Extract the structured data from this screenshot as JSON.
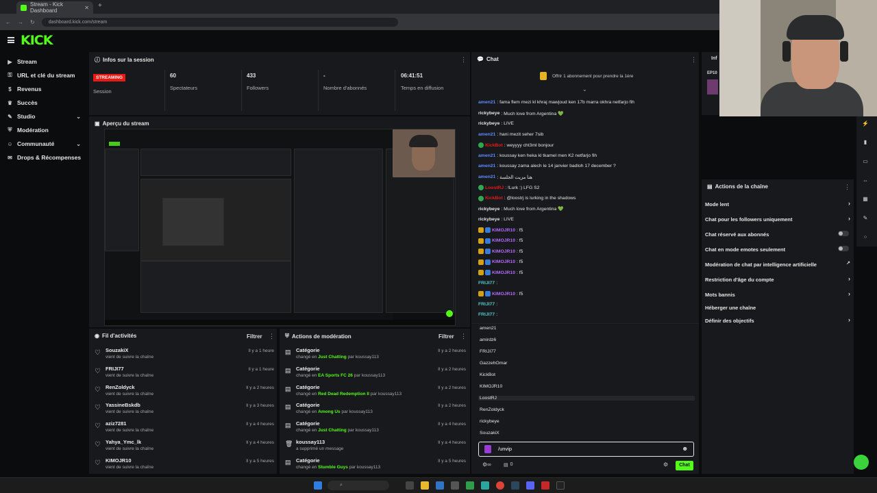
{
  "browser": {
    "tab_title": "Stream - Kick Dashboard",
    "url": "dashboard.kick.com/stream"
  },
  "brand": {
    "logo": "KICK",
    "accent": "#53fc18",
    "live_red": "#e91916"
  },
  "sidebar": {
    "items": [
      {
        "label": "Stream",
        "icon": "video-icon",
        "chevron": false,
        "active": true
      },
      {
        "label": "URL et clé du stream",
        "icon": "key-icon",
        "chevron": false
      },
      {
        "label": "Revenus",
        "icon": "money-icon",
        "chevron": false
      },
      {
        "label": "Succès",
        "icon": "trophy-icon",
        "chevron": false
      },
      {
        "label": "Studio",
        "icon": "studio-icon",
        "chevron": true
      },
      {
        "label": "Modération",
        "icon": "shield-icon",
        "chevron": false
      },
      {
        "label": "Communauté",
        "icon": "community-icon",
        "chevron": true
      },
      {
        "label": "Drops & Récompenses",
        "icon": "gift-icon",
        "chevron": false
      }
    ]
  },
  "session": {
    "title": "Infos sur la session",
    "status_badge": "STREAMING",
    "status_label": "Session",
    "stats": [
      {
        "value": "60",
        "label": "Spectateurs"
      },
      {
        "value": "433",
        "label": "Followers"
      },
      {
        "value": "-",
        "label": "Nombre d'abonnés"
      },
      {
        "value": "06:41:51",
        "label": "Temps en diffusion"
      }
    ]
  },
  "preview": {
    "title": "Aperçu du stream"
  },
  "activity": {
    "title": "Fil d'activités",
    "filter_label": "Filtrer",
    "rows": [
      {
        "name": "SouzakiX",
        "desc": "vient de suivre la chaîne",
        "time": "Il y a 1 heure"
      },
      {
        "name": "FRIJI77",
        "desc": "vient de suivre la chaîne",
        "time": "Il y a 1 heure"
      },
      {
        "name": "RenZoldyck",
        "desc": "vient de suivre la chaîne",
        "time": "Il y a 2 heures"
      },
      {
        "name": "YassineBskdb",
        "desc": "vient de suivre la chaîne",
        "time": "Il y a 3 heures"
      },
      {
        "name": "aziz7281",
        "desc": "vient de suivre la chaîne",
        "time": "Il y a 4 heures"
      },
      {
        "name": "Yahya_Ymc_lk",
        "desc": "vient de suivre la chaîne",
        "time": "Il y a 4 heures"
      },
      {
        "name": "KIMOJR10",
        "desc": "vient de suivre la chaîne",
        "time": "Il y a 5 heures"
      }
    ]
  },
  "moderation": {
    "title": "Actions de modération",
    "filter_label": "Filtrer",
    "rows": [
      {
        "icon": "category-icon",
        "name": "Catégorie",
        "pre": "changé en ",
        "game": "Just Chatting",
        "by": " par koussay113",
        "time": "Il y a 2 heures"
      },
      {
        "icon": "category-icon",
        "name": "Catégorie",
        "pre": "changé en ",
        "game": "EA Sports FC 26",
        "by": " par koussay113",
        "time": "Il y a 2 heures"
      },
      {
        "icon": "category-icon",
        "name": "Catégorie",
        "pre": "changé en ",
        "game": "Red Dead Redemption II",
        "by": " par koussay113",
        "time": "Il y a 2 heures"
      },
      {
        "icon": "category-icon",
        "name": "Catégorie",
        "pre": "changé en ",
        "game": "Among Us",
        "by": " par koussay113",
        "time": "Il y a 2 heures"
      },
      {
        "icon": "category-icon",
        "name": "Catégorie",
        "pre": "changé en ",
        "game": "Just Chatting",
        "by": " par koussay113",
        "time": "Il y a 4 heures"
      },
      {
        "icon": "trash-icon",
        "name": "koussay113",
        "pre": "a supprimé un message",
        "game": "",
        "by": "",
        "time": "Il y a 4 heures"
      },
      {
        "icon": "category-icon",
        "name": "Catégorie",
        "pre": "changé en ",
        "game": "Stumble Guys",
        "by": " par koussay113",
        "time": "Il y a 5 heures"
      }
    ]
  },
  "chat": {
    "title": "Chat",
    "sub_prompt": "Offrir 1 abonnement pour prendre la 1ère",
    "messages": [
      {
        "user": "amen21",
        "color": "#5b8cff",
        "text": ": fama flem mezi kl khraj mawjoud ken 17b marra okhra netfarjo fih"
      },
      {
        "user": "rickybeye",
        "color": "#e6e6e6",
        "text": ": Much love from Argentina 💚"
      },
      {
        "user": "rickybeye",
        "color": "#e6e6e6",
        "text": ": LIVE"
      },
      {
        "user": "amen21",
        "color": "#5b8cff",
        "text": ": hani mezit seher 7sib"
      },
      {
        "user": "KickBot",
        "color": "#e91916",
        "text": ": weyyyy cht3ml bonjour"
      },
      {
        "user": "amen21",
        "color": "#5b8cff",
        "text": ": koussay ken heka kl tkamel men K2 netfarjo fih"
      },
      {
        "user": "amen21",
        "color": "#5b8cff",
        "text": ": koussay zama alech le 14 janvier badloh 17 december ?"
      },
      {
        "user": "amen21",
        "color": "#5b8cff",
        "text": ": هنا مزيت الجلسة"
      },
      {
        "user": "LoostRJ",
        "color": "#e91916",
        "text": ": !Lurk :) LFG S2"
      },
      {
        "user": "KickBot",
        "color": "#e91916",
        "text": ": @loostrj is lurking in the shadows"
      },
      {
        "user": "rickybeye",
        "color": "#e6e6e6",
        "text": ": Much love from Argentina 💚"
      },
      {
        "user": "rickybeye",
        "color": "#e6e6e6",
        "text": ": LIVE"
      },
      {
        "user": "KIMOJR10",
        "color": "#b36bff",
        "text": ": f5"
      },
      {
        "user": "KIMOJR10",
        "color": "#b36bff",
        "text": ": f5"
      },
      {
        "user": "KIMOJR10",
        "color": "#b36bff",
        "text": ": f5"
      },
      {
        "user": "KIMOJR10",
        "color": "#b36bff",
        "text": ": f5"
      },
      {
        "user": "KIMOJR10",
        "color": "#b36bff",
        "text": ": f5"
      },
      {
        "user": "FRIJI77",
        "color": "#53c8c8",
        "text": ":"
      },
      {
        "user": "KIMOJR10",
        "color": "#b36bff",
        "text": ": f5"
      },
      {
        "user": "FRIJI77",
        "color": "#53c8c8",
        "text": ":"
      },
      {
        "user": "FRIJI77",
        "color": "#53c8c8",
        "text": ":"
      }
    ],
    "suggestions": [
      "amen21",
      "amirdz6",
      "FRIJI77",
      "GazzehOmar",
      "KickBot",
      "KIMOJR10",
      "LoostRJ",
      "RenZoldyck",
      "rickybeye",
      "SouzakiX"
    ],
    "input_value": "/unvip",
    "send_label": "Chat",
    "counter": "0"
  },
  "channel_actions": {
    "title": "Actions de la chaîne",
    "rows": [
      {
        "label": "Mode lent",
        "control": "chevron"
      },
      {
        "label": "Chat pour les followers uniquement",
        "control": "chevron"
      },
      {
        "label": "Chat réservé aux abonnés",
        "control": "toggle"
      },
      {
        "label": "Chat en mode emotes seulement",
        "control": "toggle"
      },
      {
        "label": "Modération de chat par intelligence artificielle",
        "control": "external"
      },
      {
        "label": "Restriction d'âge du compte",
        "control": "chevron"
      },
      {
        "label": "Mots bannis",
        "control": "chevron"
      },
      {
        "label": "Héberger une chaîne",
        "control": "none"
      },
      {
        "label": "Définir des objectifs",
        "control": "chevron"
      }
    ]
  },
  "right_partial": {
    "title": "Inf",
    "label": "EP10"
  }
}
